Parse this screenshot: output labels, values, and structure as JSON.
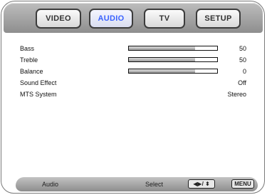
{
  "tabs": [
    {
      "label": "VIDEO",
      "active": false
    },
    {
      "label": "AUDIO",
      "active": true
    },
    {
      "label": "TV",
      "active": false
    },
    {
      "label": "SETUP",
      "active": false
    }
  ],
  "settings": [
    {
      "label": "Bass",
      "value": "50",
      "level": 0.75
    },
    {
      "label": "Treble",
      "value": "50",
      "level": 0.75
    },
    {
      "label": "Balance",
      "value": "0",
      "level": 0.75
    },
    {
      "label": "Sound Effect",
      "value": "Off"
    },
    {
      "label": "MTS System",
      "value": "Stereo"
    }
  ],
  "footer": {
    "context": "Audio",
    "hint": "Select",
    "nav_key": "◀▶/ ⬍",
    "menu_key": "MENU"
  },
  "colors": {
    "active_tab_text": "#3a62ff"
  }
}
